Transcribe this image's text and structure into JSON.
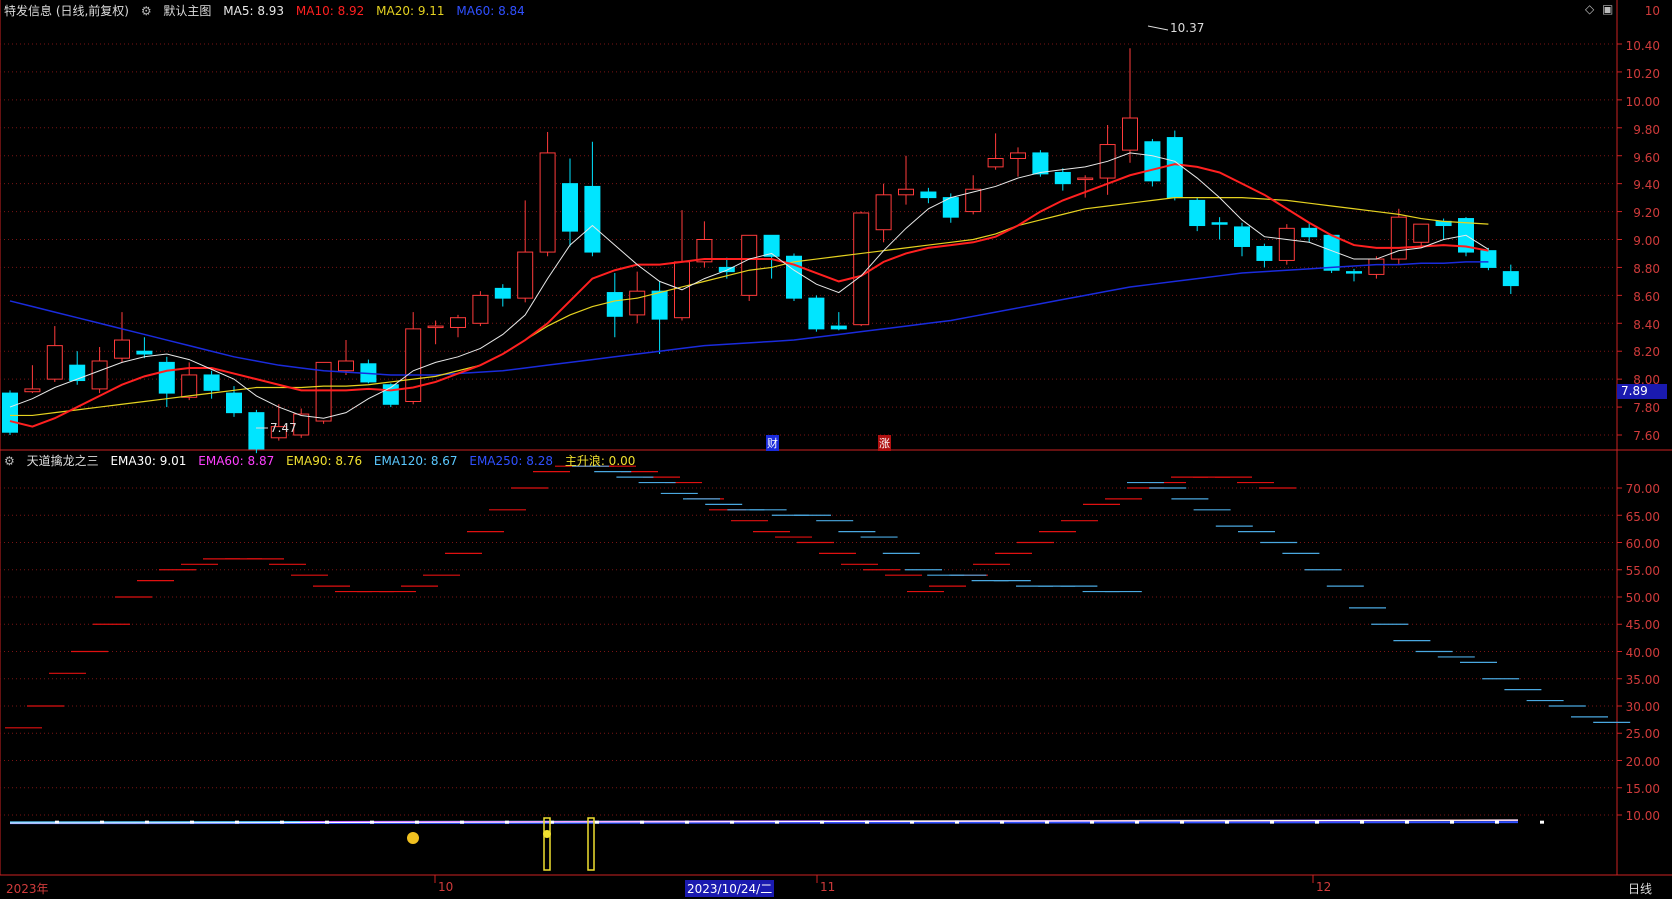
{
  "colors": {
    "up": "#ff3b3b",
    "down": "#00e5ff",
    "grid": "#7a1414",
    "axis": "#c22",
    "ma5": "#e8e8e8",
    "ma10": "#ff2020",
    "ma20": "#e5d220",
    "ma60": "#1a2bdc",
    "ema30": "#ffffff",
    "ema60": "#ff40ff",
    "ema90": "#f0e030",
    "ema120": "#5ac8ff",
    "ema250": "#3050ff"
  },
  "header": {
    "title": "特发信息 (日线,前复权)",
    "main_label": "默认主图",
    "ma5": "MA5: 8.93",
    "ma10": "MA10: 8.92",
    "ma20": "MA20: 9.11",
    "ma60": "MA60: 8.84"
  },
  "sub_header": {
    "name": "天道擒龙之三",
    "ema30": "EMA30: 9.01",
    "ema60": "EMA60: 8.87",
    "ema90": "EMA90: 8.76",
    "ema120": "EMA120: 8.67",
    "ema250": "EMA250: 8.28",
    "wave": "主升浪: 0.00"
  },
  "price_axis": [
    "10.40",
    "10.20",
    "10.00",
    "9.80",
    "9.60",
    "9.40",
    "9.20",
    "9.00",
    "8.80",
    "8.60",
    "8.40",
    "8.20",
    "8.00",
    "7.80",
    "7.60"
  ],
  "price_axis_top": "10",
  "current_price": "7.89",
  "sub_axis": [
    "70.00",
    "65.00",
    "60.00",
    "55.00",
    "50.00",
    "45.00",
    "40.00",
    "35.00",
    "30.00",
    "25.00",
    "20.00",
    "15.00",
    "10.00"
  ],
  "x_axis": {
    "labels": [
      "2023年",
      "10",
      "11",
      "12"
    ],
    "cursor_date": "2023/10/24/二",
    "period": "日线"
  },
  "annotations": {
    "high": "10.37",
    "low": "7.47",
    "marker_cai": "财",
    "marker_zhang": "涨"
  },
  "chart_data": {
    "type": "candlestick",
    "ylim": [
      7.45,
      10.45
    ],
    "candles": [
      {
        "o": 7.9,
        "h": 7.92,
        "c": 7.62,
        "l": 7.6
      },
      {
        "o": 7.91,
        "h": 8.1,
        "c": 7.93,
        "l": 7.9
      },
      {
        "o": 8.0,
        "h": 8.38,
        "c": 8.24,
        "l": 7.98
      },
      {
        "o": 8.1,
        "h": 8.2,
        "c": 7.99,
        "l": 7.96
      },
      {
        "o": 7.93,
        "h": 8.23,
        "c": 8.13,
        "l": 7.9
      },
      {
        "o": 8.15,
        "h": 8.48,
        "c": 8.28,
        "l": 8.12
      },
      {
        "o": 8.2,
        "h": 8.3,
        "c": 8.18,
        "l": 8.15
      },
      {
        "o": 8.12,
        "h": 8.16,
        "c": 7.9,
        "l": 7.8
      },
      {
        "o": 7.87,
        "h": 8.12,
        "c": 8.03,
        "l": 7.85
      },
      {
        "o": 8.03,
        "h": 8.06,
        "c": 7.92,
        "l": 7.86
      },
      {
        "o": 7.9,
        "h": 7.95,
        "c": 7.76,
        "l": 7.73
      },
      {
        "o": 7.76,
        "h": 7.78,
        "c": 7.5,
        "l": 7.47
      },
      {
        "o": 7.58,
        "h": 7.82,
        "c": 7.66,
        "l": 7.56
      },
      {
        "o": 7.6,
        "h": 7.79,
        "c": 7.75,
        "l": 7.58
      },
      {
        "o": 7.7,
        "h": 8.1,
        "c": 8.12,
        "l": 7.68
      },
      {
        "o": 8.06,
        "h": 8.28,
        "c": 8.13,
        "l": 8.03
      },
      {
        "o": 8.11,
        "h": 8.14,
        "c": 7.98,
        "l": 7.97
      },
      {
        "o": 7.96,
        "h": 7.97,
        "c": 7.82,
        "l": 7.8
      },
      {
        "o": 7.84,
        "h": 8.48,
        "c": 8.36,
        "l": 7.82
      },
      {
        "o": 8.37,
        "h": 8.42,
        "c": 8.38,
        "l": 8.25
      },
      {
        "o": 8.37,
        "h": 8.46,
        "c": 8.44,
        "l": 8.3
      },
      {
        "o": 8.4,
        "h": 8.63,
        "c": 8.6,
        "l": 8.38
      },
      {
        "o": 8.65,
        "h": 8.68,
        "c": 8.58,
        "l": 8.52
      },
      {
        "o": 8.58,
        "h": 9.28,
        "c": 8.91,
        "l": 8.55
      },
      {
        "o": 8.91,
        "h": 9.77,
        "c": 9.62,
        "l": 8.88
      },
      {
        "o": 9.4,
        "h": 9.58,
        "c": 9.06,
        "l": 8.95
      },
      {
        "o": 9.38,
        "h": 9.7,
        "c": 8.91,
        "l": 8.88
      },
      {
        "o": 8.62,
        "h": 8.76,
        "c": 8.45,
        "l": 8.3
      },
      {
        "o": 8.46,
        "h": 8.77,
        "c": 8.63,
        "l": 8.4
      },
      {
        "o": 8.63,
        "h": 8.7,
        "c": 8.43,
        "l": 8.18
      },
      {
        "o": 8.44,
        "h": 9.21,
        "c": 8.84,
        "l": 8.42
      },
      {
        "o": 8.84,
        "h": 9.13,
        "c": 9.0,
        "l": 8.8
      },
      {
        "o": 8.8,
        "h": 8.87,
        "c": 8.77,
        "l": 8.72
      },
      {
        "o": 8.6,
        "h": 9.03,
        "c": 9.03,
        "l": 8.56
      },
      {
        "o": 9.03,
        "h": 9.03,
        "c": 8.88,
        "l": 8.72
      },
      {
        "o": 8.88,
        "h": 8.9,
        "c": 8.58,
        "l": 8.56
      },
      {
        "o": 8.58,
        "h": 8.6,
        "c": 8.36,
        "l": 8.34
      },
      {
        "o": 8.38,
        "h": 8.48,
        "c": 8.36,
        "l": 8.35
      },
      {
        "o": 8.39,
        "h": 9.2,
        "c": 9.19,
        "l": 8.38
      },
      {
        "o": 9.07,
        "h": 9.4,
        "c": 9.32,
        "l": 8.98
      },
      {
        "o": 9.32,
        "h": 9.6,
        "c": 9.36,
        "l": 9.25
      },
      {
        "o": 9.34,
        "h": 9.37,
        "c": 9.3,
        "l": 9.26
      },
      {
        "o": 9.3,
        "h": 9.33,
        "c": 9.16,
        "l": 9.12
      },
      {
        "o": 9.2,
        "h": 9.46,
        "c": 9.36,
        "l": 9.18
      },
      {
        "o": 9.52,
        "h": 9.76,
        "c": 9.58,
        "l": 9.5
      },
      {
        "o": 9.58,
        "h": 9.66,
        "c": 9.62,
        "l": 9.45
      },
      {
        "o": 9.62,
        "h": 9.64,
        "c": 9.47,
        "l": 9.45
      },
      {
        "o": 9.48,
        "h": 9.51,
        "c": 9.4,
        "l": 9.35
      },
      {
        "o": 9.43,
        "h": 9.46,
        "c": 9.44,
        "l": 9.3
      },
      {
        "o": 9.44,
        "h": 9.82,
        "c": 9.68,
        "l": 9.32
      },
      {
        "o": 9.64,
        "h": 10.37,
        "c": 9.87,
        "l": 9.55
      },
      {
        "o": 9.7,
        "h": 9.72,
        "c": 9.42,
        "l": 9.38
      },
      {
        "o": 9.73,
        "h": 9.78,
        "c": 9.3,
        "l": 9.28
      },
      {
        "o": 9.28,
        "h": 9.3,
        "c": 9.1,
        "l": 9.06
      },
      {
        "o": 9.12,
        "h": 9.16,
        "c": 9.11,
        "l": 9.0
      },
      {
        "o": 9.09,
        "h": 9.12,
        "c": 8.95,
        "l": 8.88
      },
      {
        "o": 8.95,
        "h": 8.97,
        "c": 8.85,
        "l": 8.8
      },
      {
        "o": 8.85,
        "h": 9.11,
        "c": 9.08,
        "l": 8.82
      },
      {
        "o": 9.08,
        "h": 9.12,
        "c": 9.02,
        "l": 8.98
      },
      {
        "o": 9.03,
        "h": 9.03,
        "c": 8.78,
        "l": 8.76
      },
      {
        "o": 8.77,
        "h": 8.79,
        "c": 8.76,
        "l": 8.7
      },
      {
        "o": 8.75,
        "h": 8.88,
        "c": 8.86,
        "l": 8.72
      },
      {
        "o": 8.86,
        "h": 9.22,
        "c": 9.16,
        "l": 8.82
      },
      {
        "o": 8.98,
        "h": 9.11,
        "c": 9.11,
        "l": 8.95
      },
      {
        "o": 9.13,
        "h": 9.15,
        "c": 9.1,
        "l": 9.0
      },
      {
        "o": 9.15,
        "h": 9.16,
        "c": 8.91,
        "l": 8.88
      },
      {
        "o": 8.92,
        "h": 8.94,
        "c": 8.8,
        "l": 8.78
      },
      {
        "o": 8.77,
        "h": 8.82,
        "c": 8.67,
        "l": 8.61
      }
    ],
    "ma5": [
      7.8,
      7.86,
      7.94,
      8.0,
      8.06,
      8.12,
      8.16,
      8.18,
      8.14,
      8.07,
      8.0,
      7.88,
      7.8,
      7.74,
      7.72,
      7.76,
      7.86,
      7.94,
      8.06,
      8.12,
      8.16,
      8.22,
      8.32,
      8.46,
      8.72,
      8.96,
      9.1,
      8.96,
      8.82,
      8.7,
      8.64,
      8.72,
      8.78,
      8.86,
      8.9,
      8.78,
      8.68,
      8.62,
      8.74,
      8.92,
      9.08,
      9.22,
      9.3,
      9.34,
      9.38,
      9.44,
      9.48,
      9.5,
      9.52,
      9.56,
      9.62,
      9.6,
      9.56,
      9.44,
      9.3,
      9.14,
      9.02,
      9.0,
      8.98,
      8.92,
      8.86,
      8.86,
      8.92,
      8.94,
      9.0,
      9.03,
      8.93
    ],
    "ma10": [
      7.7,
      7.66,
      7.72,
      7.8,
      7.88,
      7.96,
      8.02,
      8.06,
      8.08,
      8.08,
      8.04,
      8.0,
      7.96,
      7.92,
      7.92,
      7.92,
      7.93,
      7.92,
      7.94,
      7.98,
      8.04,
      8.1,
      8.18,
      8.28,
      8.4,
      8.56,
      8.72,
      8.78,
      8.82,
      8.82,
      8.84,
      8.86,
      8.86,
      8.86,
      8.86,
      8.82,
      8.76,
      8.7,
      8.74,
      8.84,
      8.9,
      8.94,
      8.96,
      8.98,
      9.02,
      9.1,
      9.2,
      9.28,
      9.34,
      9.4,
      9.46,
      9.5,
      9.54,
      9.52,
      9.48,
      9.4,
      9.32,
      9.22,
      9.12,
      9.03,
      8.96,
      8.94,
      8.94,
      8.95,
      8.96,
      8.95,
      8.92
    ],
    "ma20": [
      7.74,
      7.74,
      7.76,
      7.78,
      7.8,
      7.82,
      7.84,
      7.86,
      7.88,
      7.9,
      7.92,
      7.94,
      7.94,
      7.94,
      7.95,
      7.95,
      7.96,
      7.98,
      8.0,
      8.02,
      8.06,
      8.1,
      8.18,
      8.28,
      8.38,
      8.46,
      8.52,
      8.56,
      8.58,
      8.62,
      8.66,
      8.7,
      8.74,
      8.78,
      8.8,
      8.84,
      8.86,
      8.88,
      8.9,
      8.92,
      8.94,
      8.96,
      8.98,
      9.0,
      9.04,
      9.1,
      9.14,
      9.18,
      9.22,
      9.24,
      9.26,
      9.28,
      9.3,
      9.3,
      9.3,
      9.3,
      9.29,
      9.28,
      9.26,
      9.24,
      9.22,
      9.2,
      9.18,
      9.15,
      9.13,
      9.12,
      9.11
    ],
    "ma60": [
      8.56,
      8.52,
      8.48,
      8.44,
      8.4,
      8.36,
      8.32,
      8.28,
      8.24,
      8.2,
      8.16,
      8.13,
      8.1,
      8.08,
      8.06,
      8.05,
      8.04,
      8.03,
      8.03,
      8.03,
      8.04,
      8.05,
      8.06,
      8.08,
      8.1,
      8.12,
      8.14,
      8.16,
      8.18,
      8.2,
      8.22,
      8.24,
      8.25,
      8.26,
      8.27,
      8.28,
      8.3,
      8.32,
      8.34,
      8.36,
      8.38,
      8.4,
      8.42,
      8.45,
      8.48,
      8.51,
      8.54,
      8.57,
      8.6,
      8.63,
      8.66,
      8.68,
      8.7,
      8.72,
      8.74,
      8.76,
      8.77,
      8.78,
      8.79,
      8.8,
      8.81,
      8.82,
      8.82,
      8.83,
      8.83,
      8.84,
      8.84
    ],
    "sub_red_dashes": [
      26,
      30,
      36,
      40,
      45,
      50,
      53,
      55,
      56,
      57,
      57,
      57,
      56,
      54,
      52,
      51,
      51,
      51,
      52,
      54,
      58,
      62,
      66,
      70,
      73,
      74,
      74,
      74,
      73,
      72,
      71,
      68,
      66,
      64,
      62,
      61,
      60,
      58,
      56,
      55,
      54,
      51,
      52,
      54,
      56,
      58,
      60,
      62,
      64,
      67,
      68,
      70,
      71,
      72,
      72,
      72,
      71,
      70
    ],
    "sub_blue_dashes": [
      74,
      73,
      72,
      71,
      69,
      68,
      67,
      66,
      66,
      65,
      65,
      64,
      62,
      61,
      58,
      55,
      54,
      54,
      53,
      53,
      52,
      52,
      52,
      51,
      51,
      71,
      70,
      68,
      66,
      63,
      62,
      60,
      58,
      55,
      52,
      48,
      45,
      42,
      40,
      39,
      38,
      35,
      33,
      31,
      30,
      28,
      27
    ]
  }
}
